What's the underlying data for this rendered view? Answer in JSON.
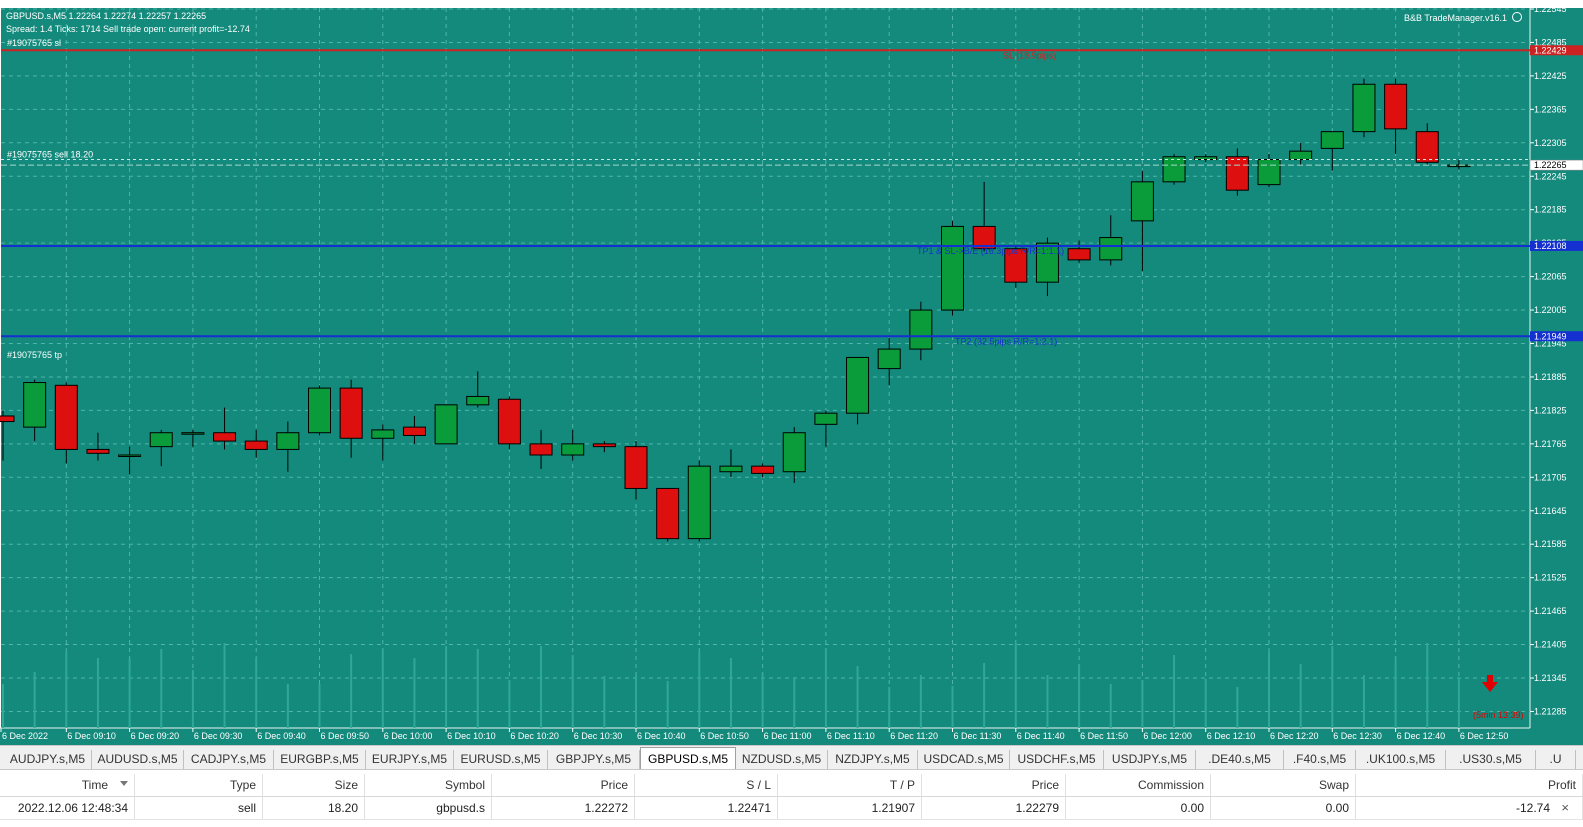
{
  "chart_data": {
    "type": "candlestick",
    "symbol_header": "GBPUSD.s,M5  1.22264 1.22274 1.22257 1.22265",
    "info_line": "Spread: 1.4  Ticks: 1714  Sell trade open: current profit=-12.74",
    "indicator": "B&B TradeManager.v16.1",
    "ylim": [
      1.21255,
      1.22575
    ],
    "y_ticks": [
      "1.22545",
      "1.22485",
      "1.22425",
      "1.22365",
      "1.22305",
      "1.22245",
      "1.22185",
      "1.22125",
      "1.22065",
      "1.22005",
      "1.21945",
      "1.21885",
      "1.21825",
      "1.21765",
      "1.21705",
      "1.21645",
      "1.21585",
      "1.21525",
      "1.21465",
      "1.21405",
      "1.21345",
      "1.21285"
    ],
    "x_ticks": [
      "6 Dec 2022",
      "6 Dec 09:10",
      "6 Dec 09:20",
      "6 Dec 09:30",
      "6 Dec 09:40",
      "6 Dec 09:50",
      "6 Dec 10:00",
      "6 Dec 10:10",
      "6 Dec 10:20",
      "6 Dec 10:30",
      "6 Dec 10:40",
      "6 Dec 10:50",
      "6 Dec 11:00",
      "6 Dec 11:10",
      "6 Dec 11:20",
      "6 Dec 11:30",
      "6 Dec 11:40",
      "6 Dec 11:50",
      "6 Dec 12:00",
      "6 Dec 12:10",
      "6 Dec 12:20",
      "6 Dec 12:30",
      "6 Dec 12:40",
      "6 Dec 12:50"
    ],
    "candles": [
      [
        1.21815,
        1.21825,
        1.21735,
        1.21805
      ],
      [
        1.21795,
        1.2188,
        1.2177,
        1.21875
      ],
      [
        1.2187,
        1.21875,
        1.2173,
        1.21755
      ],
      [
        1.21755,
        1.21785,
        1.21735,
        1.21748
      ],
      [
        1.21745,
        1.2176,
        1.2171,
        1.21745
      ],
      [
        1.2176,
        1.2179,
        1.21725,
        1.21785
      ],
      [
        1.21785,
        1.2179,
        1.2176,
        1.21785
      ],
      [
        1.21785,
        1.2183,
        1.21755,
        1.2177
      ],
      [
        1.2177,
        1.2179,
        1.2174,
        1.21755
      ],
      [
        1.21755,
        1.21805,
        1.21715,
        1.21785
      ],
      [
        1.21785,
        1.2187,
        1.2178,
        1.21865
      ],
      [
        1.21865,
        1.2188,
        1.2174,
        1.21775
      ],
      [
        1.21775,
        1.218,
        1.21735,
        1.2179
      ],
      [
        1.21795,
        1.21815,
        1.21765,
        1.2178
      ],
      [
        1.21765,
        1.21835,
        1.21765,
        1.21835
      ],
      [
        1.21835,
        1.21895,
        1.2183,
        1.2185
      ],
      [
        1.21845,
        1.2185,
        1.21755,
        1.21765
      ],
      [
        1.21765,
        1.2179,
        1.2172,
        1.21745
      ],
      [
        1.21745,
        1.2179,
        1.21735,
        1.21765
      ],
      [
        1.21765,
        1.2177,
        1.2175,
        1.2176
      ],
      [
        1.2176,
        1.2177,
        1.21665,
        1.21685
      ],
      [
        1.21685,
        1.21685,
        1.2159,
        1.21595
      ],
      [
        1.21595,
        1.21735,
        1.2159,
        1.21725
      ],
      [
        1.21715,
        1.21755,
        1.21705,
        1.21725
      ],
      [
        1.21725,
        1.2173,
        1.21705,
        1.21712
      ],
      [
        1.21715,
        1.21795,
        1.21695,
        1.21785
      ],
      [
        1.218,
        1.21825,
        1.2176,
        1.2182
      ],
      [
        1.2182,
        1.2192,
        1.218,
        1.2192
      ],
      [
        1.219,
        1.21955,
        1.2187,
        1.21935
      ],
      [
        1.21935,
        1.2202,
        1.21915,
        1.22005
      ],
      [
        1.22005,
        1.22165,
        1.21995,
        1.22155
      ],
      [
        1.22155,
        1.22235,
        1.2211,
        1.22115
      ],
      [
        1.22115,
        1.2212,
        1.22045,
        1.22055
      ],
      [
        1.22055,
        1.22135,
        1.2203,
        1.22125
      ],
      [
        1.22115,
        1.2213,
        1.2209,
        1.22095
      ],
      [
        1.22095,
        1.22175,
        1.22085,
        1.22135
      ],
      [
        1.22165,
        1.22255,
        1.22075,
        1.22235
      ],
      [
        1.22235,
        1.22285,
        1.2223,
        1.2228
      ],
      [
        1.22275,
        1.22285,
        1.2227,
        1.2228
      ],
      [
        1.2228,
        1.22295,
        1.2221,
        1.2222
      ],
      [
        1.2223,
        1.22285,
        1.22225,
        1.22275
      ],
      [
        1.22275,
        1.22305,
        1.22265,
        1.2229
      ],
      [
        1.22295,
        1.22325,
        1.22255,
        1.22325
      ],
      [
        1.22325,
        1.2242,
        1.22315,
        1.2241
      ],
      [
        1.2241,
        1.2242,
        1.22285,
        1.2233
      ],
      [
        1.22325,
        1.2234,
        1.22265,
        1.2227
      ],
      [
        1.22265,
        1.22274,
        1.22257,
        1.22265
      ]
    ],
    "levels": [
      {
        "price": 1.22471,
        "color": "#cc2222",
        "label": "SL (19.9pips)",
        "axis_label": "1.22429"
      },
      {
        "price": 1.2212,
        "color": "#1530d0",
        "label": "TP1 & SL->B/E (16.3pips R/R=1:1.1)",
        "axis_label": "1.22108"
      },
      {
        "price": 1.21958,
        "color": "#1530d0",
        "label": "TP2 (32.5pips R/R=1:2.1)",
        "axis_label": "1.21949"
      }
    ],
    "bid_price": "1.22265",
    "trade_labels": [
      {
        "text": "#19075765 sl",
        "price": 1.22475
      },
      {
        "text": "#19075765 sell 18.20",
        "price": 1.22275
      },
      {
        "text": "#19075765 tp",
        "price": 1.21915
      }
    ],
    "timer_text": "(5min 13:39)",
    "grid": true,
    "colors": {
      "background": "#138a7c",
      "bull": "#0a9b3a",
      "bear": "#dd0f0f",
      "grid": "#4fb5a9",
      "text": "#ffffff"
    }
  },
  "symbol_tabs": [
    "AUDJPY.s,M5",
    "AUDUSD.s,M5",
    "CADJPY.s,M5",
    "EURGBP.s,M5",
    "EURJPY.s,M5",
    "EURUSD.s,M5",
    "GBPJPY.s,M5",
    "GBPUSD.s,M5",
    "NZDUSD.s,M5",
    "NZDJPY.s,M5",
    "USDCAD.s,M5",
    "USDCHF.s,M5",
    "USDJPY.s,M5",
    ".DE40.s,M5",
    ".F40.s,M5",
    ".UK100.s,M5",
    ".US30.s,M5",
    ".U"
  ],
  "active_tab": "GBPUSD.s,M5",
  "trades": {
    "headers": [
      "Time",
      "Type",
      "Size",
      "Symbol",
      "Price",
      "S / L",
      "T / P",
      "Price",
      "Commission",
      "Swap",
      "Profit"
    ],
    "rows": [
      [
        "2022.12.06 12:48:34",
        "sell",
        "18.20",
        "gbpusd.s",
        "1.22272",
        "1.22471",
        "1.21907",
        "1.22279",
        "0.00",
        "0.00",
        "-12.74"
      ]
    ]
  }
}
